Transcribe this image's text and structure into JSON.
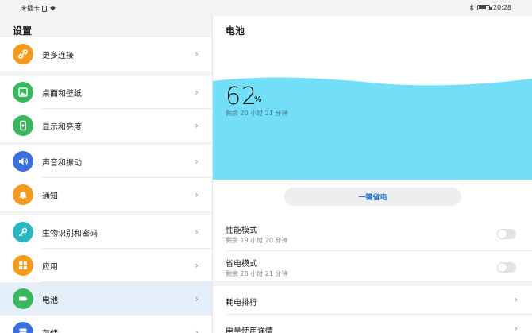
{
  "status_bar": {
    "carrier": "未插卡",
    "time": "20:28",
    "battery_level": 0.62
  },
  "left_panel": {
    "title": "设置",
    "items": [
      {
        "label": "更多连接",
        "icon": "link-icon",
        "color": "#f59a1b"
      },
      {
        "label": "桌面和壁纸",
        "icon": "image-icon",
        "color": "#37b85c"
      },
      {
        "label": "显示和亮度",
        "icon": "phone-brightness-icon",
        "color": "#37b85c"
      },
      {
        "label": "声音和振动",
        "icon": "speaker-icon",
        "color": "#3b6fe0"
      },
      {
        "label": "通知",
        "icon": "bell-icon",
        "color": "#f59a1b"
      },
      {
        "label": "生物识别和密码",
        "icon": "key-icon",
        "color": "#2bb6c4"
      },
      {
        "label": "应用",
        "icon": "apps-grid-icon",
        "color": "#f59a1b"
      },
      {
        "label": "电池",
        "icon": "battery-icon",
        "color": "#37b85c"
      },
      {
        "label": "存储",
        "icon": "storage-icon",
        "color": "#3b6fe0"
      }
    ]
  },
  "right_panel": {
    "title": "电池",
    "percent": "62",
    "percent_sign": "%",
    "remaining": "剩余 20 小时 21 分钟",
    "save_button": "一键省电",
    "modes": [
      {
        "title": "性能模式",
        "subtitle": "剩余 19 小时 20 分钟",
        "enabled": false
      },
      {
        "title": "省电模式",
        "subtitle": "剩余 28 小时 21 分钟",
        "enabled": false
      }
    ],
    "rows": [
      {
        "label": "耗电排行"
      },
      {
        "label": "电量使用详情"
      }
    ]
  },
  "colors": {
    "wave": "#73def8",
    "accent": "#1b6fcf",
    "selected": "#e3eef9"
  }
}
